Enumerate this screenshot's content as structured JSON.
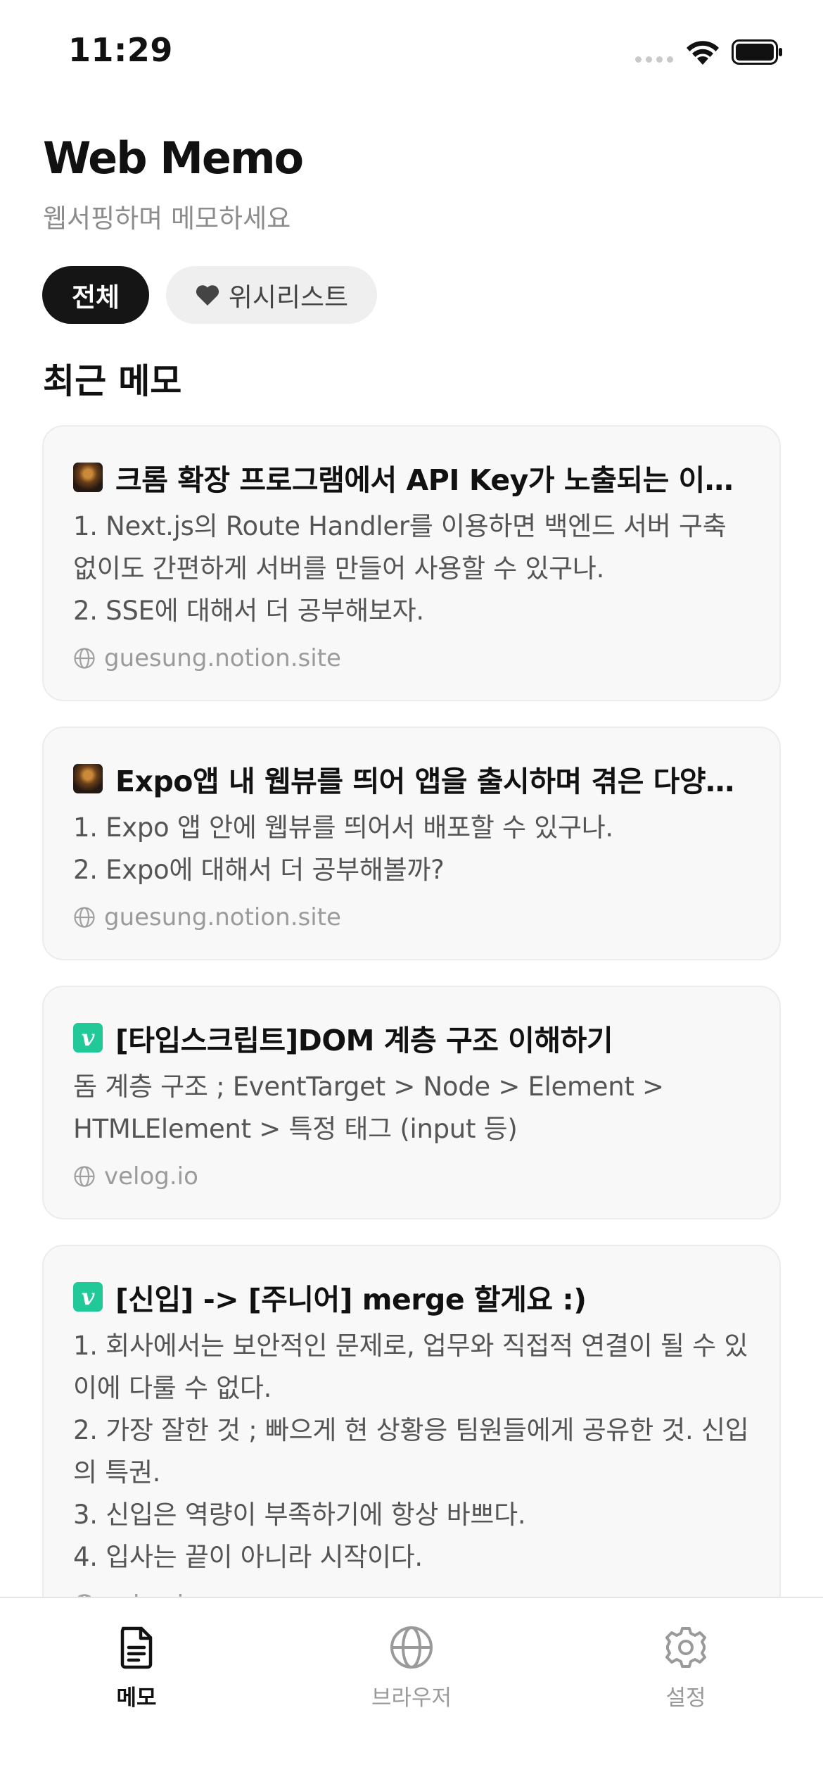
{
  "status_bar": {
    "time": "11:29"
  },
  "header": {
    "title": "Web Memo",
    "subtitle": "웹서핑하며 메모하세요"
  },
  "filters": {
    "all": "전체",
    "wishlist": "위시리스트",
    "wishlist_icon": "heart-icon"
  },
  "section_title": "최근 메모",
  "memos": [
    {
      "favicon": "notion-thumbnail",
      "title": "크롬 확장 프로그램에서 API Key가 노출되는 이슈를 해결하며",
      "body": "1. Next.js의 Route Handler를 이용하면 백엔드 서버 구축 없이도 간편하게 서버를 만들어 사용할 수 있구나.\n2. SSE에 대해서 더 공부해보자.",
      "source": "guesung.notion.site"
    },
    {
      "favicon": "notion-thumbnail",
      "title": "Expo앱 내 웹뷰를 띄어 앱을 출시하며 겪은 다양한 이슈들",
      "body": "1. Expo 앱 안에 웹뷰를 띄어서 배포할 수 있구나.\n2. Expo에 대해서 더 공부해볼까?",
      "source": "guesung.notion.site"
    },
    {
      "favicon": "velog",
      "favicon_text": "v",
      "title": "[타입스크립트]DOM 계층 구조 이해하기",
      "body": "돔 계층 구조 ; EventTarget > Node > Element > HTMLElement > 특정 태그 (input 등)",
      "source": "velog.io"
    },
    {
      "favicon": "velog",
      "favicon_text": "v",
      "title": "[신입] -> [주니어] merge 할게요 :)",
      "body": "1. 회사에서는 보안적인 문제로, 업무와 직접적 연결이 될 수 있이에 다룰 수 없다.\n2. 가장 잘한 것 ; 빠으게 현 상황응 팀원들에게 공유한 것. 신입의 특권.\n3. 신입은 역량이 부족하기에 항상 바쁘다.\n4. 입사는 끝이 아니라 시작이다.",
      "source": "velog.io"
    }
  ],
  "tabs": [
    {
      "label": "메모",
      "icon": "document-icon",
      "active": true
    },
    {
      "label": "브라우저",
      "icon": "globe-icon",
      "active": false
    },
    {
      "label": "설정",
      "icon": "gear-icon",
      "active": false
    }
  ]
}
